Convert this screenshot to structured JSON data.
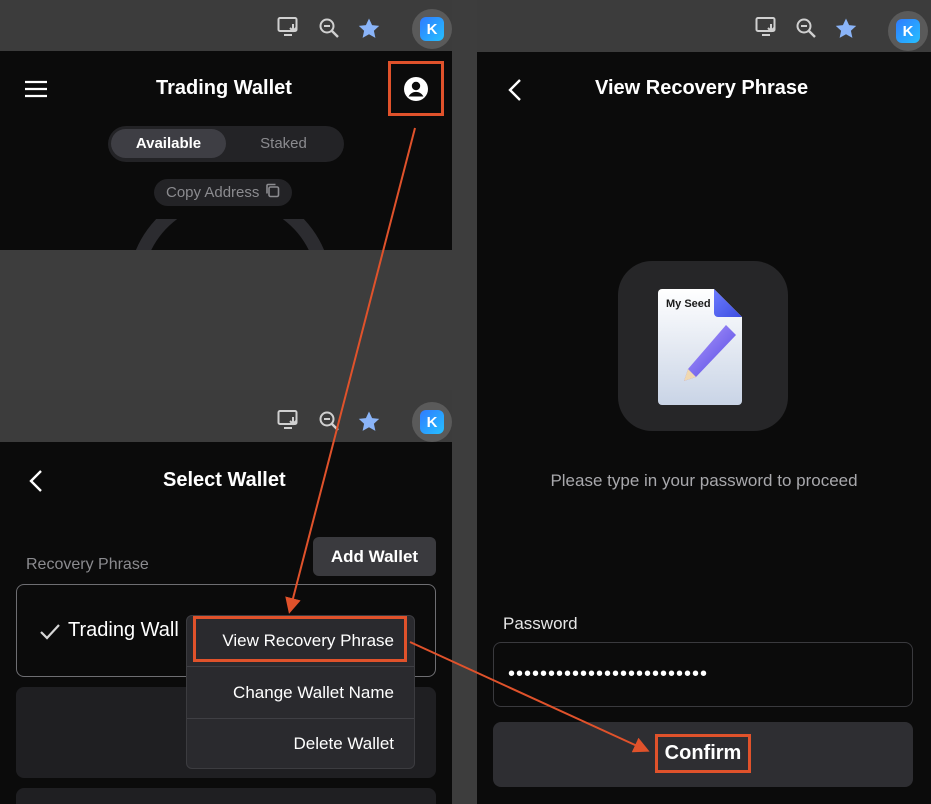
{
  "colors": {
    "highlight": "#e0522b",
    "background": "#0b0b0b",
    "browser_bar": "#3c3c3c",
    "star": "#8ab4f8"
  },
  "browser": {
    "icons": [
      "install-app-icon",
      "zoom-out-icon",
      "bookmark-star-icon",
      "extension-k-icon"
    ],
    "extension_letter": "K"
  },
  "trading_wallet_screen": {
    "menu_icon": "hamburger-menu-icon",
    "title": "Trading Wallet",
    "account_icon": "account-circle-icon",
    "tabs": [
      "Available",
      "Staked"
    ],
    "active_tab": "Available",
    "copy_address_label": "Copy Address",
    "copy_icon": "copy-icon"
  },
  "select_wallet_screen": {
    "back_icon": "chevron-left-icon",
    "title": "Select Wallet",
    "section_label": "Recovery Phrase",
    "add_wallet_label": "Add Wallet",
    "wallet_name": "Trading Wall",
    "check_icon": "checkmark-icon",
    "context_menu": [
      "View Recovery Phrase",
      "Change Wallet Name",
      "Delete Wallet"
    ]
  },
  "recovery_screen": {
    "back_icon": "chevron-left-icon",
    "title": "View Recovery Phrase",
    "seed_image_label": "My Seed",
    "prompt": "Please type in your password to proceed",
    "password_label": "Password",
    "password_value": "•••••••••••••••••••••••••",
    "confirm_label": "Confirm"
  }
}
